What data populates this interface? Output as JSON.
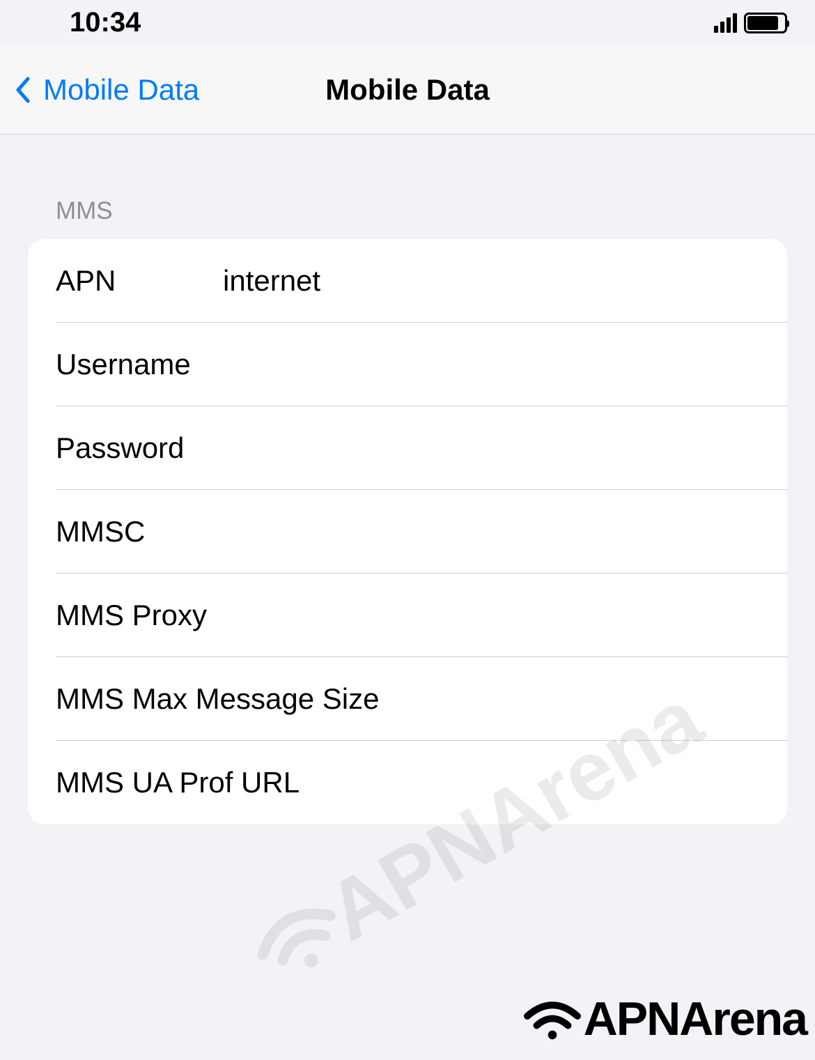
{
  "status_bar": {
    "time": "10:34"
  },
  "nav": {
    "back_label": "Mobile Data",
    "title": "Mobile Data"
  },
  "section": {
    "header": "MMS"
  },
  "fields": {
    "apn": {
      "label": "APN",
      "value": "internet"
    },
    "username": {
      "label": "Username",
      "value": ""
    },
    "password": {
      "label": "Password",
      "value": ""
    },
    "mmsc": {
      "label": "MMSC",
      "value": ""
    },
    "mms_proxy": {
      "label": "MMS Proxy",
      "value": ""
    },
    "mms_max": {
      "label": "MMS Max Message Size",
      "value": ""
    },
    "mms_ua": {
      "label": "MMS UA Prof URL",
      "value": ""
    }
  },
  "watermark": "APNArena",
  "brand": "APNArena"
}
